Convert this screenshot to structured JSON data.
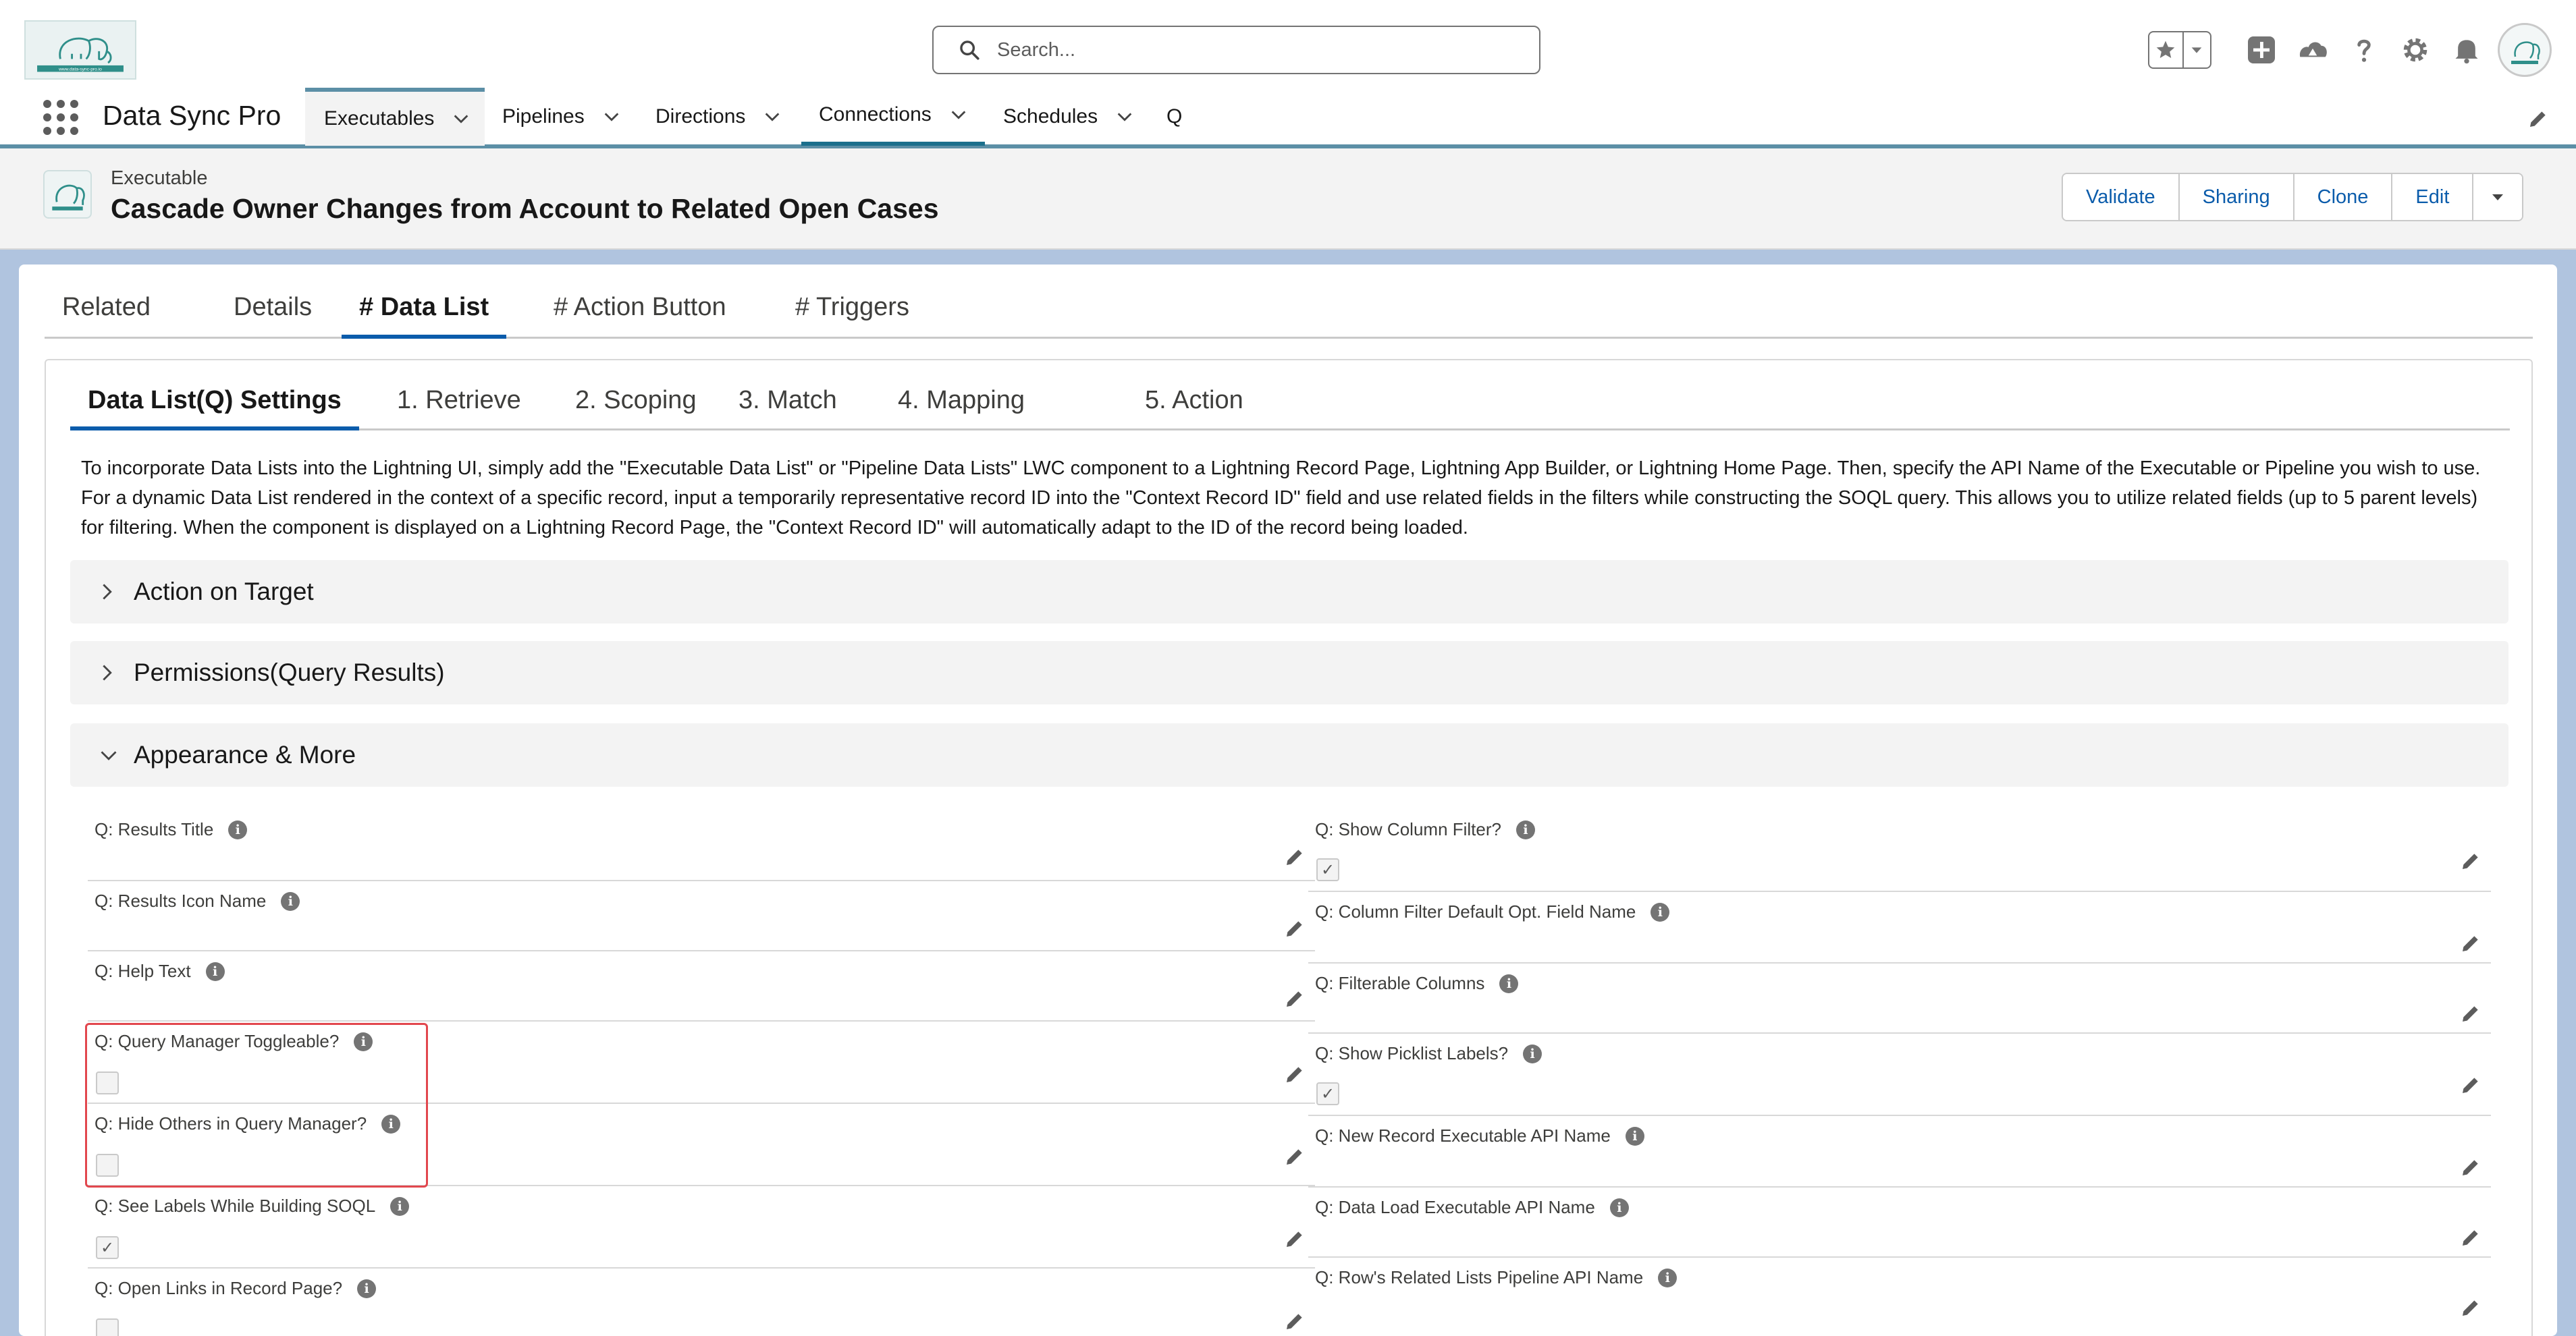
{
  "header": {
    "logo_text": "www.data-sync-pro.io",
    "search_placeholder": "Search..."
  },
  "app_nav": {
    "app_name": "Data Sync Pro",
    "items": [
      {
        "label": "Executables"
      },
      {
        "label": "Pipelines"
      },
      {
        "label": "Directions"
      },
      {
        "label": "Connections"
      },
      {
        "label": "Schedules"
      },
      {
        "label": "Q"
      }
    ]
  },
  "record": {
    "object_label": "Executable",
    "title": "Cascade Owner Changes from Account to Related Open Cases",
    "actions": [
      "Validate",
      "Sharing",
      "Clone",
      "Edit"
    ]
  },
  "tabs": [
    "Related",
    "Details",
    "# Data List",
    "# Action Button",
    "# Triggers"
  ],
  "subtabs": [
    "Data List(Q) Settings",
    "1. Retrieve",
    "2. Scoping",
    "3. Match",
    "4. Mapping",
    "5. Action"
  ],
  "intro": [
    "To incorporate Data Lists into the Lightning UI, simply add the \"Executable Data List\" or \"Pipeline Data Lists\" LWC component to a Lightning Record Page, Lightning App Builder, or Lightning Home Page. Then, specify the API Name of the Executable or Pipeline you wish to use.",
    "For a dynamic Data List rendered in the context of a specific record, input a temporarily representative record ID into the \"Context Record ID\" field and use related fields in the filters while constructing the SOQL query. This allows you to utilize related fields (up to 5 parent levels)",
    "for filtering. When the component is displayed on a Lightning Record Page, the \"Context Record ID\" will automatically adapt to the ID of the record being loaded."
  ],
  "sections": [
    {
      "label": "Action on Target",
      "state": "collapsed"
    },
    {
      "label": "Permissions(Query Results)",
      "state": "collapsed"
    },
    {
      "label": "Appearance & More",
      "state": "expanded"
    }
  ],
  "fields_left": [
    {
      "label": "Q: Results Title",
      "checkbox": null
    },
    {
      "label": "Q: Results Icon Name",
      "checkbox": null
    },
    {
      "label": "Q: Help Text",
      "checkbox": null
    },
    {
      "label": "Q: Query Manager Toggleable?",
      "checkbox": false
    },
    {
      "label": "Q: Hide Others in Query Manager?",
      "checkbox": false
    },
    {
      "label": "Q: See Labels While Building SOQL",
      "checkbox": true
    },
    {
      "label": "Q: Open Links in Record Page?",
      "checkbox": false
    }
  ],
  "fields_right": [
    {
      "label": "Q: Show Column Filter?",
      "checkbox": true
    },
    {
      "label": "Q: Column Filter Default Opt. Field Name",
      "checkbox": null
    },
    {
      "label": "Q: Filterable Columns",
      "checkbox": null
    },
    {
      "label": "Q: Show Picklist Labels?",
      "checkbox": true
    },
    {
      "label": "Q: New Record Executable API Name",
      "checkbox": null
    },
    {
      "label": "Q: Data Load Executable API Name",
      "checkbox": null
    },
    {
      "label": "Q: Row's Related Lists Pipeline API Name",
      "checkbox": null
    }
  ],
  "info_glyph": "i",
  "check_glyph": "✓",
  "colors": {
    "brand": "#0b5cab",
    "nav_accent": "#5c8fa6",
    "highlight": "#e2474e",
    "background": "#b0c4df"
  }
}
